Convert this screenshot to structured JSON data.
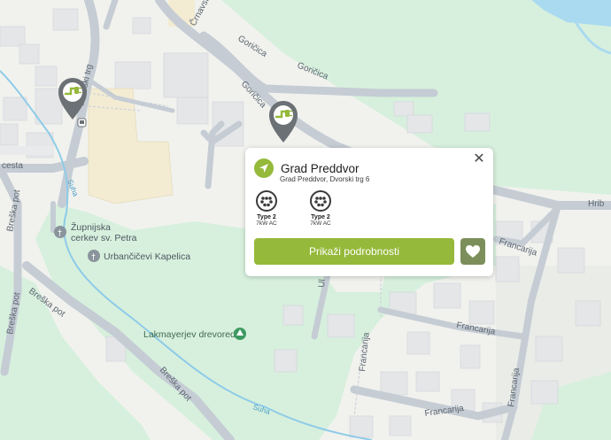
{
  "map": {
    "streets": {
      "crnavska": "Črnavska",
      "dvorski_trg": "Dvorski trg",
      "goricica_1": "Goričica",
      "goricica_2": "Goričica",
      "cesta": "cesta",
      "breska_pot_1": "Breška pot",
      "breska_pot_2": "Breška pot",
      "breska_pot_3": "Breška pot",
      "breska_pot_4": "Breška pot",
      "francarija_1": "Francarija",
      "francarija_2": "Francarija",
      "francarija_3": "Francarija",
      "francarija_4": "Francarija",
      "hrib": "Hrib",
      "ulica_partial": "Ul"
    },
    "waterways": {
      "suha_1": "Suha",
      "suha_2": "Suha"
    },
    "pois": {
      "church_line1": "Župnijska",
      "church_line2": "cerkev sv. Petra",
      "chapel": "Urbančičevi Kapelica",
      "park": "Lakmayerjev drevored"
    },
    "colors": {
      "land": "#f1f2ee",
      "green": "#d7f0dd",
      "water": "#aadaf0",
      "road": "#c5ccd4",
      "building": "#e4e6e8",
      "accent": "#95b93a",
      "pin": "#6c7175"
    }
  },
  "popup": {
    "title": "Grad Preddvor",
    "address": "Grad Preddvor, Dvorski trg 6",
    "connectors": [
      {
        "type": "Type 2",
        "power": "7kW AC"
      },
      {
        "type": "Type 2",
        "power": "7kW AC"
      }
    ],
    "details_button": "Prikaži podrobnosti",
    "close_icon": "close-icon",
    "favorite_icon": "heart-icon",
    "navigate_icon": "navigation-arrow-icon"
  }
}
